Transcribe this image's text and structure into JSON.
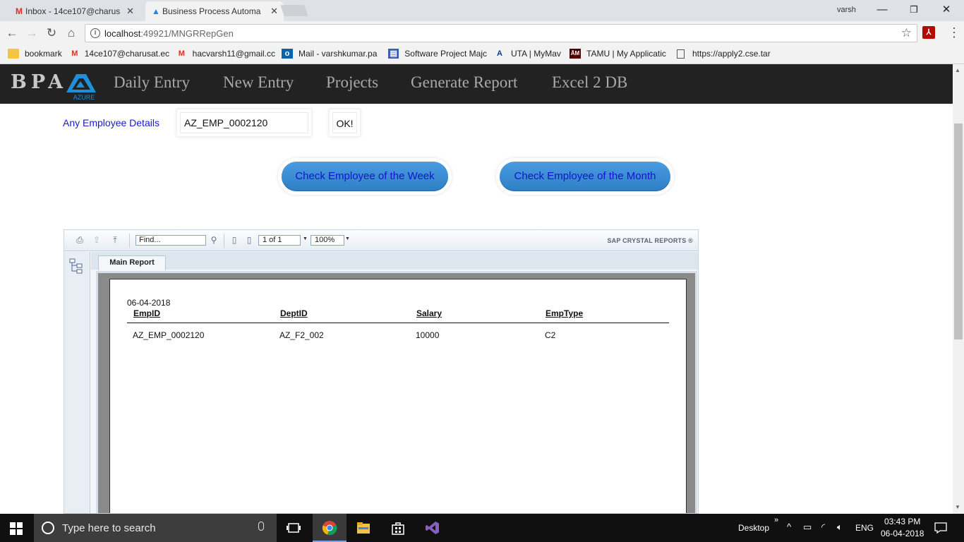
{
  "browser": {
    "tabs": [
      {
        "label": "Inbox - 14ce107@charus",
        "icon": "gmail-icon",
        "active": false
      },
      {
        "label": "Business Process Automa",
        "icon": "azure-icon",
        "active": true
      }
    ],
    "window_user": "varsh",
    "url_host": "localhost",
    "url_rest": ":49921/MNGRRepGen",
    "bookmarks": [
      {
        "label": "bookmark",
        "icon": "folder-icon"
      },
      {
        "label": "14ce107@charusat.ec",
        "icon": "gmail-icon"
      },
      {
        "label": "hacvarsh11@gmail.cc",
        "icon": "gmail-icon"
      },
      {
        "label": "Mail - varshkumar.pa",
        "icon": "outlook-icon"
      },
      {
        "label": "Software Project Majc",
        "icon": "calendar-icon"
      },
      {
        "label": "UTA | MyMav",
        "icon": "uta-icon"
      },
      {
        "label": "TAMU | My Applicatic",
        "icon": "tamu-icon"
      },
      {
        "label": "https://apply2.cse.tar",
        "icon": "page-icon"
      }
    ]
  },
  "app": {
    "brand": "BPA",
    "logo_text": "AZURE",
    "nav": [
      "Daily Entry",
      "New Entry",
      "Projects",
      "Generate Report",
      "Excel 2 DB"
    ]
  },
  "form": {
    "label": "Any Employee Details",
    "employee_id": "AZ_EMP_0002120",
    "ok_label": "OK!",
    "week_button": "Check Employee of the Week",
    "month_button": "Check Employee of the Month"
  },
  "crystal": {
    "find_placeholder": "Find...",
    "page_indicator": "1 of 1",
    "zoom": "100%",
    "brand": "SAP CRYSTAL REPORTS ®",
    "tab": "Main Report",
    "report": {
      "date": "06-04-2018",
      "columns": [
        "EmpID",
        "DeptID",
        "Salary",
        "EmpType"
      ],
      "rows": [
        [
          "AZ_EMP_0002120",
          "AZ_F2_002",
          "10000",
          "C2"
        ]
      ]
    }
  },
  "taskbar": {
    "search_placeholder": "Type here to search",
    "desktop_label": "Desktop",
    "language": "ENG",
    "time": "03:43 PM",
    "date": "06-04-2018"
  }
}
